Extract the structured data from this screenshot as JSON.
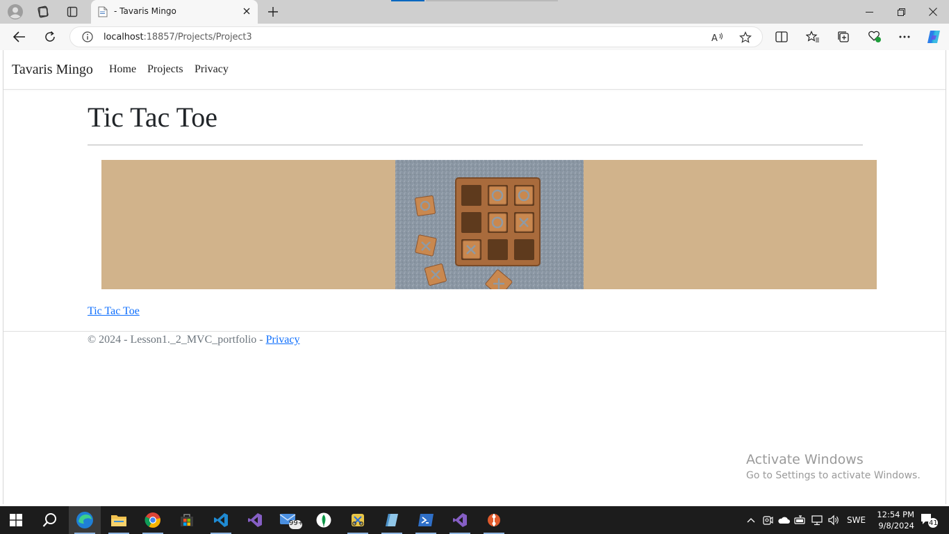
{
  "browser": {
    "tab_title": "- Tavaris Mingo",
    "url_host": "localhost",
    "url_path": ":18857/Projects/Project3"
  },
  "site": {
    "brand": "Tavaris Mingo",
    "nav": [
      {
        "label": "Home"
      },
      {
        "label": "Projects"
      },
      {
        "label": "Privacy"
      }
    ]
  },
  "main": {
    "title": "Tic Tac Toe",
    "project_link": "Tic Tac Toe"
  },
  "footer": {
    "text": "© 2024 - Lesson1._2_MVC_portfolio - ",
    "privacy_link": "Privacy"
  },
  "watermark": {
    "line1": "Activate Windows",
    "line2": "Go to Settings to activate Windows."
  },
  "taskbar": {
    "mail_badge": "99+",
    "language": "SWE",
    "time": "12:54 PM",
    "date": "9/8/2024",
    "notification_count": "41"
  },
  "colors": {
    "banner_bg": "#d1b38b",
    "link": "#0d6efd",
    "accent": "#0067c0"
  }
}
